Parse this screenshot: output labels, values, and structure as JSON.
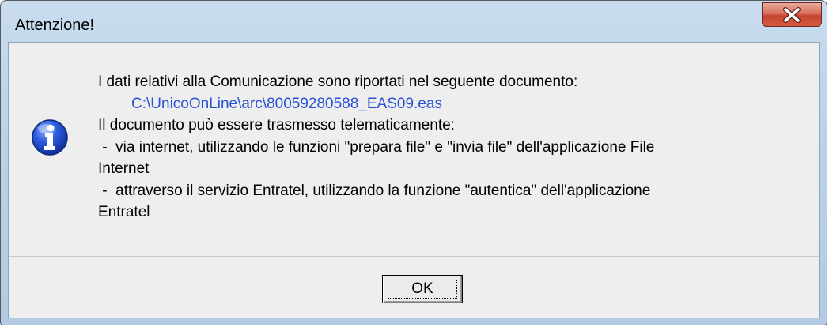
{
  "window": {
    "title": "Attenzione!"
  },
  "titlebar": {
    "close_icon": "close-x-icon"
  },
  "dialog": {
    "icon": "information-icon",
    "message_lines": [
      "I dati relativi alla Comunicazione sono riportati nel seguente documento:",
      "C:\\UnicoOnLine\\arc\\80059280588_EAS09.eas",
      "Il documento può essere trasmesso telematicamente:",
      " -  via internet, utilizzando le funzioni \"prepara file\" e \"invia file\" dell'applicazione File",
      "Internet",
      " -  attraverso il servizio Entratel, utilizzando la funzione \"autentica\" dell'applicazione",
      "Entratel"
    ],
    "ok_label": "OK"
  },
  "colors": {
    "path_text": "#2a52d6",
    "close_button": "#c5432d",
    "info_icon": "#1a49c9"
  }
}
